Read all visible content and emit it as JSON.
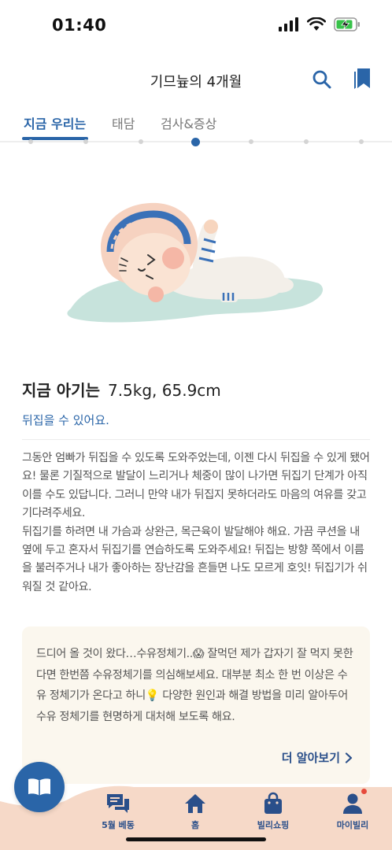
{
  "status_bar": {
    "time": "01:40"
  },
  "header": {
    "title": "기므늎의 4개월",
    "search_icon": "search-icon",
    "bookmark_icon": "bookmark-icon"
  },
  "tabs": [
    {
      "label": "지금 우리는",
      "active": true
    },
    {
      "label": "태담",
      "active": false
    },
    {
      "label": "검사&증상",
      "active": false
    }
  ],
  "baby": {
    "heading_label": "지금 아기는",
    "stats": "7.5kg, 65.9cm",
    "milestone": "뒤집을 수 있어요.",
    "description": [
      "그동안 엄빠가 뒤집을 수 있도록 도와주었는데, 이젠 다시 뒤집을 수 있게 됐어요! 물론 기질적으로 발달이 느리거나 체중이 많이 나가면 뒤집기 단계가 아직 이를 수도 있답니다. 그러니 만약 내가 뒤집지 못하더라도 마음의 여유를 갖고 기다려주세요.",
      "뒤집기를 하려면 내 가슴과 상완근, 목근육이 발달해야 해요. 가끔 쿠션을 내 옆에 두고 혼자서 뒤집기를 연습하도록 도와주세요! 뒤집는 방향 쪽에서 이름을 불러주거나 내가 좋아하는 장난감을 흔들면 나도 모르게 호잇! 뒤집기가 쉬워질 것 같아요."
    ]
  },
  "card": {
    "text": "드디어 올 것이 왔다…수유정체기..😱 잘먹던 제가 갑자기 잘 먹지 못한다면 한번쯤 수유정체기를 의심해보세요. 대부분 최소 한 번 이상은 수유 정체기가 온다고 하니💡 다양한 원인과 해결 방법을 미리 알아두어 수유 정체기를 현명하게 대처해 보도록 해요.",
    "more_label": "더 알아보기"
  },
  "bottom_nav": [
    {
      "label": "5월 베동",
      "icon": "chat-icon"
    },
    {
      "label": "홈",
      "icon": "home-icon"
    },
    {
      "label": "빌리쇼핑",
      "icon": "shopping-bag-icon"
    },
    {
      "label": "마이빌리",
      "icon": "person-icon",
      "badge": true
    }
  ],
  "colors": {
    "primary": "#2a65a8",
    "navy": "#2a4f8a",
    "card_bg": "#fbf7ee",
    "nav_bg": "#f6d9c8",
    "badge": "#e64a3c"
  }
}
